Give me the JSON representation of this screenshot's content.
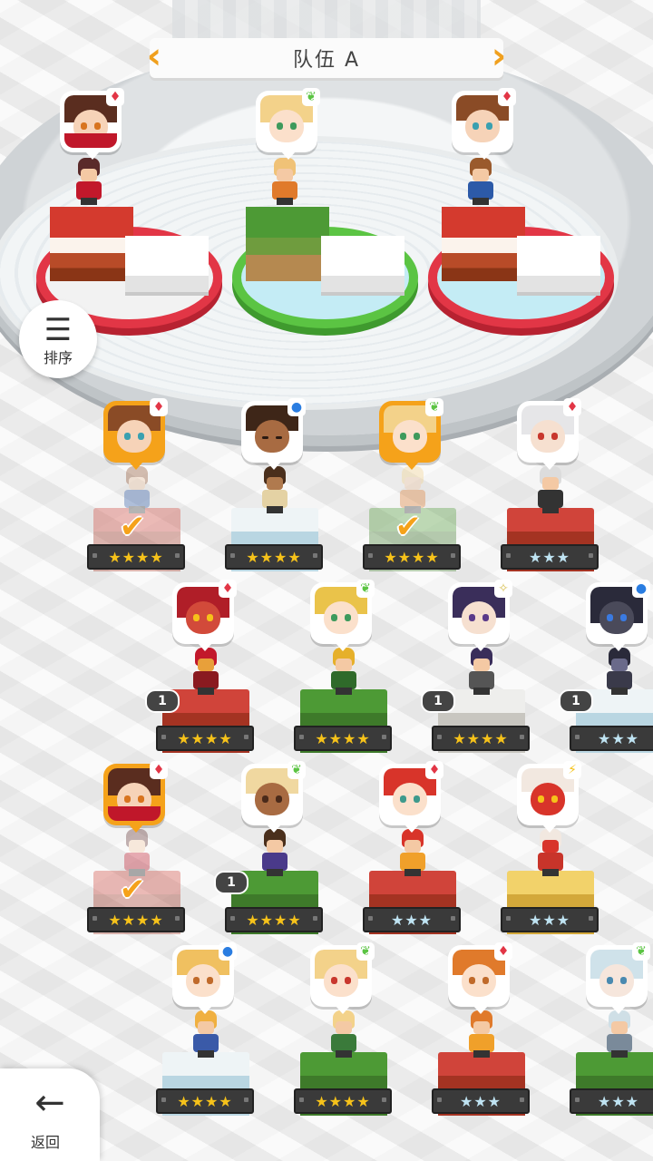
{
  "team": {
    "title": "队伍 A"
  },
  "sort_button": {
    "label": "排序"
  },
  "back_button": {
    "label": "返回"
  },
  "colors": {
    "accent": "#f5a21a",
    "fire": "#e23646",
    "grass": "#5bc443",
    "water": "#2a7de1",
    "light": "#f5c21a"
  },
  "team_slots": [
    {
      "element": "fire",
      "ring": "red"
    },
    {
      "element": "grass",
      "ring": "green"
    },
    {
      "element": "fire",
      "ring": "red"
    }
  ],
  "heroes": [
    {
      "element": "fire",
      "stars": "★★★★",
      "star_type": "gold",
      "selected": true
    },
    {
      "element": "water",
      "stars": "★★★★",
      "star_type": "gold",
      "selected": false
    },
    {
      "element": "grass",
      "stars": "★★★★",
      "star_type": "gold",
      "selected": true
    },
    {
      "element": "fire",
      "stars": "★★★",
      "star_type": "silver",
      "selected": false
    },
    {
      "element": "fire",
      "stars": "★★★★",
      "star_type": "gold",
      "selected": false,
      "copies": "1"
    },
    {
      "element": "grass",
      "stars": "★★★★",
      "star_type": "gold",
      "selected": false
    },
    {
      "element": "light",
      "stars": "★★★★",
      "star_type": "gold",
      "selected": false,
      "copies": "1"
    },
    {
      "element": "water",
      "stars": "★★★",
      "star_type": "silver",
      "selected": false,
      "copies": "1"
    },
    {
      "element": "fire",
      "stars": "★★★★",
      "star_type": "gold",
      "selected": true
    },
    {
      "element": "grass",
      "stars": "★★★★",
      "star_type": "gold",
      "selected": false,
      "copies": "1"
    },
    {
      "element": "fire",
      "stars": "★★★",
      "star_type": "silver",
      "selected": false
    },
    {
      "element": "light",
      "stars": "★★★",
      "star_type": "silver",
      "selected": false
    },
    {
      "element": "water",
      "stars": "★★★★",
      "star_type": "gold",
      "selected": false
    },
    {
      "element": "grass",
      "stars": "★★★★",
      "star_type": "gold",
      "selected": false
    },
    {
      "element": "fire",
      "stars": "★★★",
      "star_type": "silver",
      "selected": false
    },
    {
      "element": "grass",
      "stars": "★★★",
      "star_type": "silver",
      "selected": false
    }
  ]
}
